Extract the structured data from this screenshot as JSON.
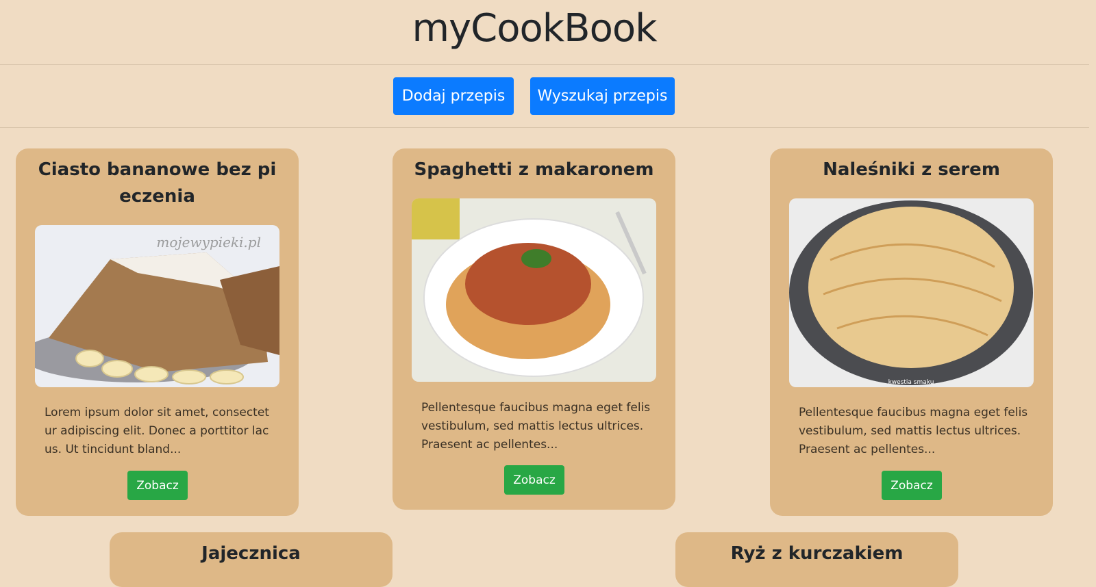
{
  "app": {
    "title": "myCookBook"
  },
  "nav": {
    "add_label": "Dodaj przepis",
    "search_label": "Wyszukaj przepis"
  },
  "cards": [
    {
      "title": "Ciasto bananowe bez pieczenia",
      "text": "Lorem ipsum dolor sit amet, consectetur adipiscing elit. Donec a porttitor lacus. Ut tincidunt bland...",
      "button": "Zobacz",
      "image_watermark": "mojewypieki.pl"
    },
    {
      "title": "Spaghetti z makaronem",
      "text": "Pellentesque faucibus magna eget felis vestibulum, sed mattis lectus ultrices. Praesent ac pellentes...",
      "button": "Zobacz"
    },
    {
      "title": "Naleśniki z serem",
      "text": "Pellentesque faucibus magna eget felis vestibulum, sed mattis lectus ultrices. Praesent ac pellentes...",
      "button": "Zobacz",
      "image_watermark": "kwestia smaku"
    },
    {
      "title": "Jajecznica"
    },
    {
      "title": "Ryż z kurczakiem"
    }
  ],
  "colors": {
    "page_bg": "#f0dcc3",
    "card_bg": "#deb887",
    "primary": "#0b7bff",
    "success": "#28a745"
  }
}
